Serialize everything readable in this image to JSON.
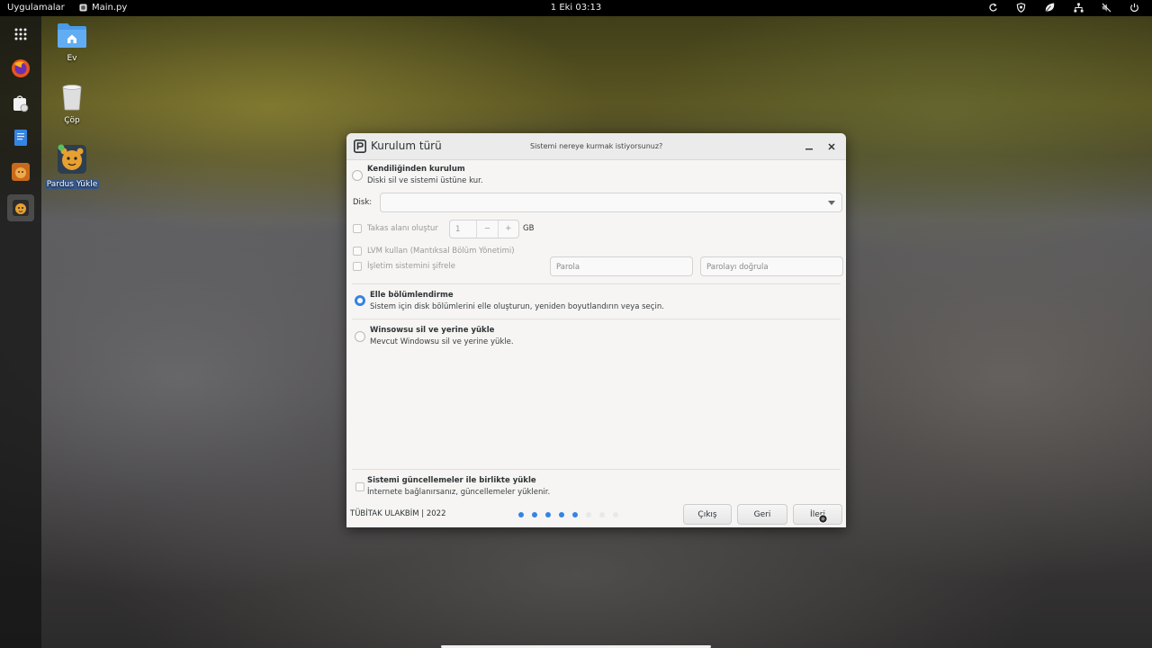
{
  "topbar": {
    "apps_label": "Uygulamalar",
    "app_name": "Main.py",
    "clock": "1 Eki  03:13"
  },
  "desktop": {
    "icons": [
      {
        "label": "Ev"
      },
      {
        "label": "Çöp"
      },
      {
        "label": "Pardus Yükle"
      }
    ]
  },
  "dialog": {
    "title": "Kurulum türü",
    "subtitle": "Sistemi nereye kurmak istiyorsunuz?",
    "auto": {
      "title": "Kendiliğinden kurulum",
      "desc": "Diski sil ve sistemi üstüne kur."
    },
    "disk_label": "Disk:",
    "swap": {
      "label": "Takas alanı oluştur",
      "value": "1",
      "minus": "−",
      "plus": "+",
      "unit": "GB"
    },
    "lvm_label": "LVM kullan (Mantıksal Bölüm Yönetimi)",
    "encrypt_label": "İşletim sistemini şifrele",
    "password_placeholder": "Parola",
    "password_confirm_placeholder": "Parolayı doğrula",
    "manual": {
      "title": "Elle bölümlendirme",
      "desc": "Sistem için disk bölümlerini elle oluşturun, yeniden boyutlandırın veya seçin."
    },
    "windows": {
      "title": "Winsowsu sil ve yerine yükle",
      "desc": "Mevcut Windowsu sil ve yerine yükle."
    },
    "updates": {
      "title": "Sistemi güncellemeler ile birlikte yükle",
      "desc": "İnternete bağlanırsanız, güncellemeler yüklenir."
    },
    "footer": "TÜBİTAK ULAKBİM | 2022",
    "buttons": {
      "quit": "Çıkış",
      "back": "Geri",
      "next": "İleri"
    },
    "progress": {
      "current_step": 5,
      "total_steps": 8
    }
  },
  "colors": {
    "accent": "#3584e4",
    "topbar": "#000000"
  }
}
